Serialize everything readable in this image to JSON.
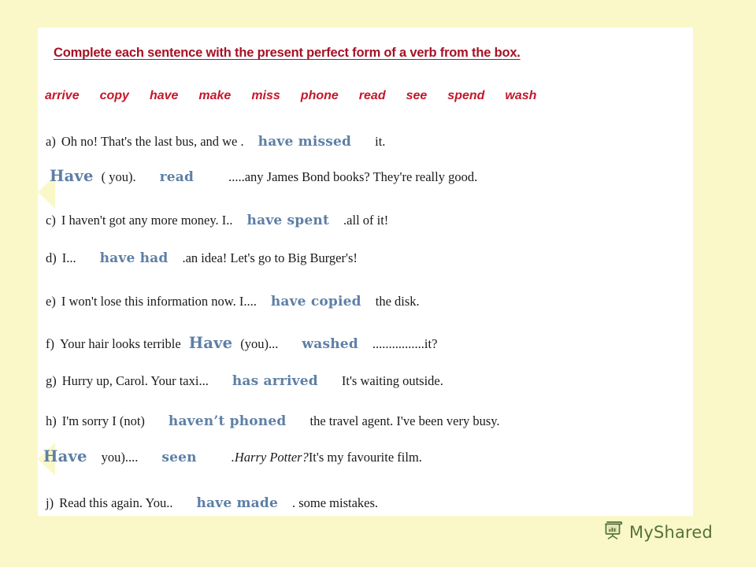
{
  "heading": "Complete each sentence with the present perfect form of a verb from the box.",
  "verb_box": [
    "arrive",
    "copy",
    "have",
    "make",
    "miss",
    "phone",
    "read",
    "see",
    "spend",
    "wash"
  ],
  "colors": {
    "page_background": "#faf8c8",
    "card_background": "#ffffff",
    "heading_red": "#a51226",
    "verb_red": "#c4172b",
    "answer_blue": "#5d7fa6",
    "body_text": "#1a1a1a",
    "watermark_green": "#4e6b37"
  },
  "exercises": [
    {
      "label": "a)",
      "pre": "Oh no! That's the last bus, and we .",
      "answer": "have missed",
      "post": "it."
    },
    {
      "label": "",
      "answer_lead": "Have",
      "pre": "( you).",
      "answer": "read",
      "post": ".....any  James Bond books? They're really good."
    },
    {
      "label": "c)",
      "pre": "I haven't got any more money. I..",
      "answer": "have spent",
      "post": ".all of it!"
    },
    {
      "label": "d)",
      "pre": "I...",
      "answer": "have had",
      "post": ".an  idea! Let's go to Big Burger's!"
    },
    {
      "label": "e)",
      "pre": "I won't lose this information now. I....",
      "answer": "have copied",
      "post": "the disk."
    },
    {
      "label": "f)",
      "pre": "Your hair looks terrible",
      "answer_mid": "Have",
      "mid": "(you)...",
      "answer": "washed",
      "post": "................it?"
    },
    {
      "label": "g)",
      "pre": "Hurry up, Carol. Your taxi...",
      "answer": "has arrived",
      "post": "It's waiting outside."
    },
    {
      "label": "h)",
      "pre": "I'm sorry I (not)",
      "answer": "haven’t phoned",
      "post": "the travel agent. I've been very busy."
    },
    {
      "label": "",
      "answer_lead": "Have",
      "pre": "you)....",
      "answer": "seen",
      "post_italic": ".Harry  Potter?",
      "post": " It's my favourite film."
    },
    {
      "label": "j)",
      "pre": "Read this again. You..",
      "answer": "have made",
      "post": ".  some mistakes."
    }
  ],
  "watermark": {
    "text": "MyShared",
    "icon": "presentation-board-icon"
  }
}
